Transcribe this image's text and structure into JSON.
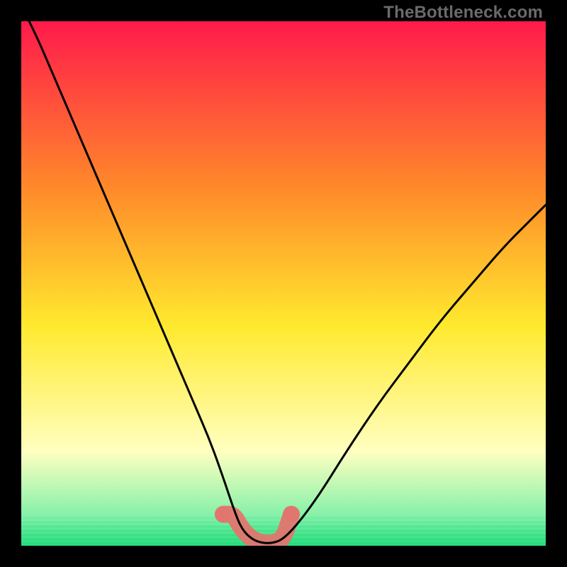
{
  "watermark": "TheBottleneck.com",
  "colors": {
    "frame": "#000000",
    "curve": "#000000",
    "band_salmon": "#e2756d",
    "band_green": "#28d67a",
    "grad_top": "#ff1a4b",
    "grad_mid1": "#ff8a2a",
    "grad_mid2": "#ffe92e",
    "grad_pale": "#ffffc0",
    "grad_bottom": "#27e07f"
  },
  "chart_data": {
    "type": "line",
    "title": "",
    "xlabel": "",
    "ylabel": "",
    "xlim": [
      0,
      100
    ],
    "ylim": [
      0,
      100
    ],
    "series": [
      {
        "name": "bottleneck-curve",
        "x": [
          0,
          3,
          6,
          9,
          12,
          15,
          18,
          21,
          24,
          27,
          30,
          33,
          36,
          38.5,
          40.5,
          42,
          44,
          46,
          48,
          50,
          53,
          57,
          62,
          68,
          74,
          80,
          86,
          92,
          97,
          100
        ],
        "y": [
          103,
          97,
          90,
          83,
          76,
          69,
          62,
          55,
          48,
          41,
          34,
          27,
          20,
          13,
          7,
          3.2,
          1.2,
          0.5,
          0.5,
          1.3,
          4.5,
          10,
          18,
          27,
          35,
          43,
          50,
          57,
          62,
          65
        ]
      }
    ],
    "highlight_band": {
      "name": "sweet-spot",
      "x_start": 38.5,
      "x_end": 51.5,
      "y_max": 6
    },
    "background_gradient_stops": [
      {
        "offset": 0.0,
        "color": "#ff1a4b"
      },
      {
        "offset": 0.32,
        "color": "#ff8a2a"
      },
      {
        "offset": 0.58,
        "color": "#ffe92e"
      },
      {
        "offset": 0.82,
        "color": "#ffffc0"
      },
      {
        "offset": 0.95,
        "color": "#7ef0a8"
      },
      {
        "offset": 1.0,
        "color": "#27e07f"
      }
    ]
  }
}
